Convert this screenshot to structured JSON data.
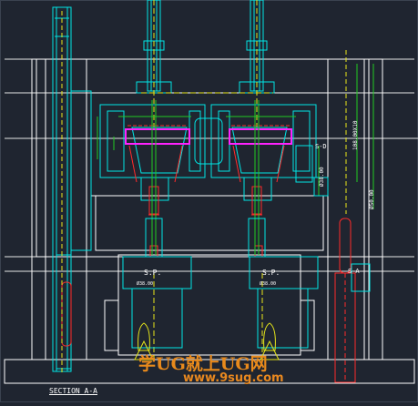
{
  "drawing": {
    "section_title": "SECTION A-A",
    "labels": {
      "sprue_left": "S.P.",
      "sprue_right": "S.P.",
      "sprue_dim_left": "Ø38.00",
      "sprue_dim_right": "Ø38.00",
      "section_d": "S-D",
      "section_a": "S-A",
      "dim_vertical_1": "108.00X10",
      "dim_vertical_2": "Ø50.00",
      "dim_vertical_3": "Ø38.00"
    },
    "watermark": {
      "line1": "学UG就上UG网",
      "line2": "www.9sug.com"
    },
    "colors": {
      "background": "#1f2530",
      "cyan": "#00e5e5",
      "white": "#ffffff",
      "yellow": "#e8e81a",
      "red": "#ff2a2a",
      "green": "#22cc22",
      "magenta": "#ff22ff"
    }
  }
}
